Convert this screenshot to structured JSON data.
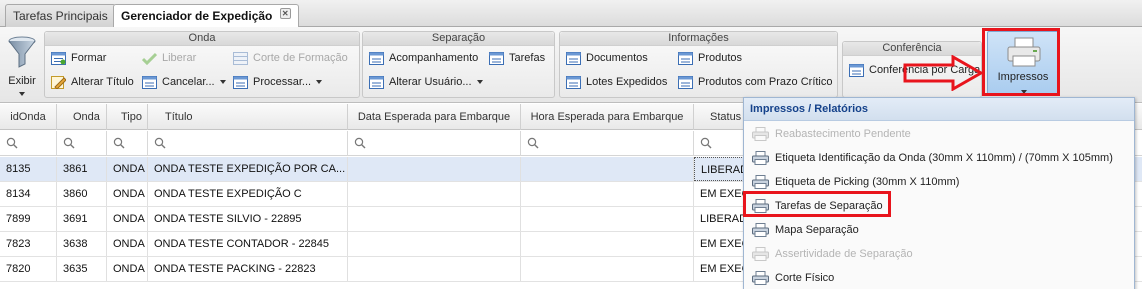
{
  "tabs": [
    {
      "label": "Tarefas Principais",
      "active": false
    },
    {
      "label": "Gerenciador de Expedição",
      "active": true,
      "close_glyph": "✕"
    }
  ],
  "ribbon": {
    "filter": {
      "label": "Exibir",
      "icon": "funnel-icon"
    },
    "groups": {
      "onda": {
        "title": "Onda",
        "formar": "Formar",
        "liberar": "Liberar",
        "corte_formacao": "Corte de Formação",
        "alterar_titulo": "Alterar Título",
        "cancelar": "Cancelar...",
        "processar": "Processar..."
      },
      "separacao": {
        "title": "Separação",
        "acompanhamento": "Acompanhamento",
        "tarefas": "Tarefas",
        "alterar_usuario": "Alterar Usuário..."
      },
      "informacoes": {
        "title": "Informações",
        "documentos": "Documentos",
        "produtos": "Produtos",
        "lotes_expedidos": "Lotes Expedidos",
        "produtos_prazo": "Produtos com Prazo Crítico"
      },
      "conferencia": {
        "title": "Conferência",
        "conferencia_carga": "Conferência por Carga"
      }
    },
    "impressos": {
      "label": "Impressos",
      "icon": "printer-icon"
    }
  },
  "grid": {
    "columns": [
      "idOnda",
      "Onda",
      "Tipo",
      "Título",
      "Data Esperada para Embarque",
      "Hora Esperada para Embarque",
      "Status"
    ],
    "rows": [
      {
        "idOnda": "8135",
        "onda": "3861",
        "tipo": "ONDA",
        "titulo": "ONDA TESTE EXPEDIÇÃO POR CA...",
        "data": "",
        "hora": "",
        "status": "LIBERADA",
        "selected": true
      },
      {
        "idOnda": "8134",
        "onda": "3860",
        "tipo": "ONDA",
        "titulo": "ONDA TESTE EXPEDIÇÃO C",
        "data": "",
        "hora": "",
        "status": "EM EXECUÇÃO",
        "selected": false
      },
      {
        "idOnda": "7899",
        "onda": "3691",
        "tipo": "ONDA",
        "titulo": "ONDA TESTE SILVIO - 22895",
        "data": "",
        "hora": "",
        "status": "LIBERADA",
        "selected": false
      },
      {
        "idOnda": "7823",
        "onda": "3638",
        "tipo": "ONDA",
        "titulo": "ONDA TESTE CONTADOR - 22845",
        "data": "",
        "hora": "",
        "status": "EM EXECUÇÃO",
        "selected": false
      },
      {
        "idOnda": "7820",
        "onda": "3635",
        "tipo": "ONDA",
        "titulo": "ONDA TESTE PACKING - 22823",
        "data": "",
        "hora": "",
        "status": "EM EXECUÇÃO",
        "selected": false
      }
    ]
  },
  "menu": {
    "title": "Impressos / Relatórios",
    "items": [
      {
        "label": "Reabastecimento Pendente",
        "enabled": false
      },
      {
        "label": "Etiqueta Identificação da Onda (30mm X 110mm) / (70mm X 105mm)",
        "enabled": true
      },
      {
        "label": "Etiqueta de Picking (30mm X 110mm)",
        "enabled": true
      },
      {
        "label": "Tarefas de Separação",
        "enabled": true,
        "highlighted": true
      },
      {
        "label": "Mapa Separação",
        "enabled": true
      },
      {
        "label": "Assertividade de Separação",
        "enabled": false
      },
      {
        "label": "Corte Físico",
        "enabled": true
      }
    ]
  },
  "colors": {
    "highlight_red": "#e8141c",
    "selected_row": "#dfe8f6",
    "menu_title": "#15428b"
  }
}
